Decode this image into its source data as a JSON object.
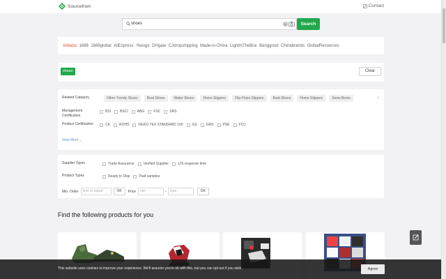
{
  "header": {
    "logo_text": "Sourcefrom",
    "contact_label": "Contact"
  },
  "search": {
    "query": "shoes",
    "button_label": "Search"
  },
  "platforms": [
    "Alibaba",
    "1688",
    "1688global",
    "AliExpress",
    "Yiwugo",
    "DHgate",
    "CJdropshipping",
    "Made-in-China",
    "LightInTheBox",
    "Banggood",
    "Chinabrands",
    "GlobalResources"
  ],
  "active_platform": "Alibaba",
  "selected_tag": {
    "label": "shoes",
    "clear_label": "Clear"
  },
  "filters": {
    "related_label": "Related Category",
    "related_items": [
      "Other Trendy Shoes",
      "Boat Shoes",
      "Water Shoes",
      "Home Slippers",
      "Flip-Flops Slippers",
      "Boat Shoes",
      "Home Slippers",
      "Snow Boots"
    ],
    "mgmt_label": "Management Certification",
    "mgmt_items": [
      "BSI",
      "BSCI",
      "ABG",
      "FSC",
      "SRS"
    ],
    "product_cert_label": "Product Certification",
    "product_cert_items": [
      "CE",
      "ROHS",
      "OEKO-TEX STANDARD 100",
      "GS",
      "GRS",
      "PSE",
      "FCC"
    ],
    "view_more": "View More"
  },
  "supplier": {
    "types_label": "Supplier Types",
    "types": [
      "Trade Assurance",
      "Verified Supplier",
      "≤1h response time"
    ],
    "product_types_label": "Product Types",
    "product_types": [
      "Ready to Ship",
      "Paid samples"
    ],
    "min_order_label": "Min. Order",
    "min_order_placeholder": "less or equal",
    "ok_label": "OK",
    "price_label": "Price",
    "price_min_placeholder": "min",
    "price_dash": "-",
    "price_max_placeholder": "max"
  },
  "products_title": "Find the following products for you",
  "cookie": {
    "text": "This website uses cookies to improve your experience. We'll assume you're ok with this, but you can opt-out if you wish.",
    "agree_label": "Agree"
  },
  "colors": {
    "accent_green": "#21a84a",
    "active_platform": "#ee4e2f",
    "link_blue": "#5b8fd9"
  }
}
